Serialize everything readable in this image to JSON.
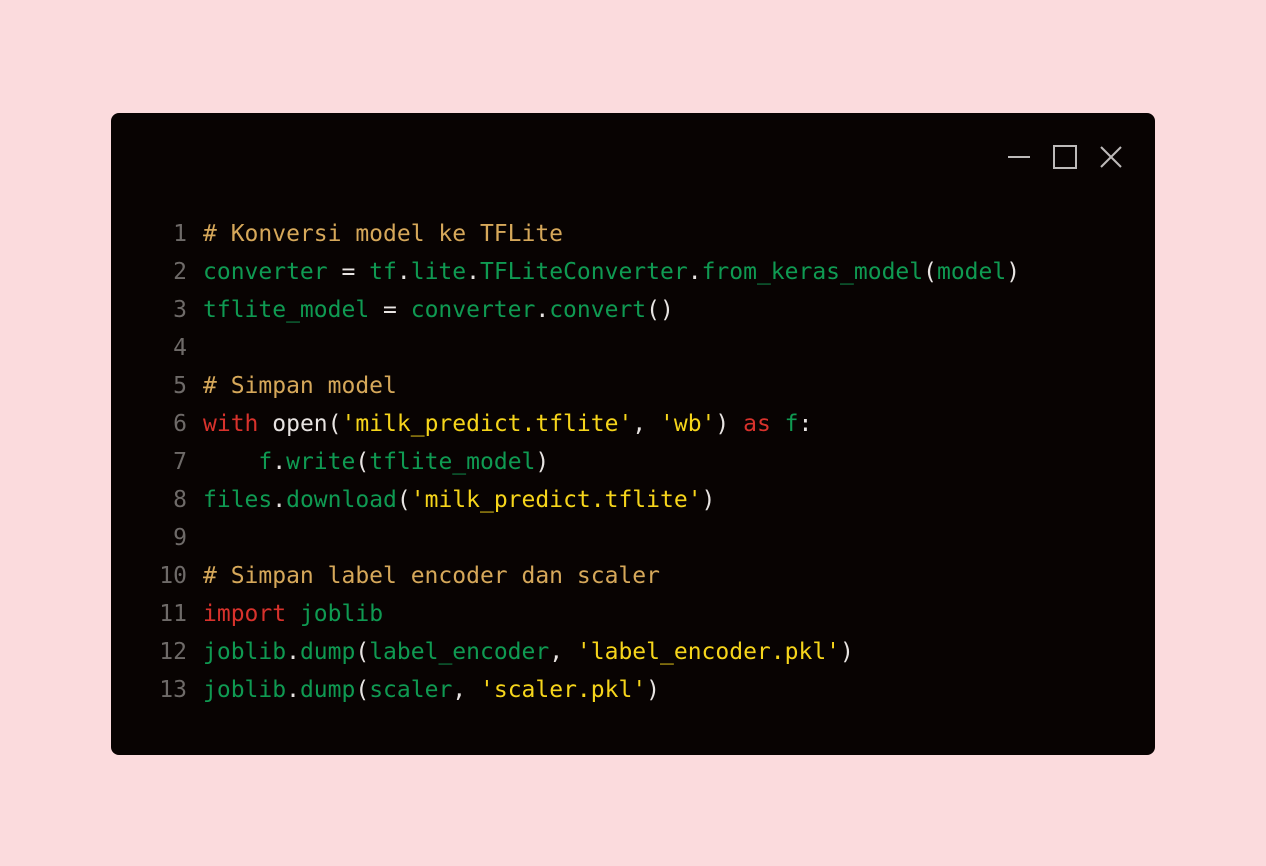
{
  "window": {
    "controls": {
      "minimize_icon": "minimize-icon",
      "maximize_icon": "maximize-icon",
      "close_icon": "close-icon"
    }
  },
  "colors": {
    "background": "#fbdbdd",
    "editor": "#080302",
    "comment": "#d6a85a",
    "keyword": "#d8322c",
    "identifier": "#0f9a52",
    "string": "#f6d51b",
    "punctuation": "#e8e4e2",
    "line_number": "#6e6a68"
  },
  "code": {
    "lines": [
      {
        "number": "1",
        "tokens": [
          {
            "t": "comment",
            "v": "# Konversi model ke TFLite"
          }
        ]
      },
      {
        "number": "2",
        "tokens": [
          {
            "t": "id",
            "v": "converter"
          },
          {
            "t": "punc",
            "v": " = "
          },
          {
            "t": "id",
            "v": "tf"
          },
          {
            "t": "punc",
            "v": "."
          },
          {
            "t": "id",
            "v": "lite"
          },
          {
            "t": "punc",
            "v": "."
          },
          {
            "t": "id",
            "v": "TFLiteConverter"
          },
          {
            "t": "punc",
            "v": "."
          },
          {
            "t": "id",
            "v": "from_keras_model"
          },
          {
            "t": "punc",
            "v": "("
          },
          {
            "t": "id",
            "v": "model"
          },
          {
            "t": "punc",
            "v": ")"
          }
        ]
      },
      {
        "number": "3",
        "tokens": [
          {
            "t": "id",
            "v": "tflite_model"
          },
          {
            "t": "punc",
            "v": " = "
          },
          {
            "t": "id",
            "v": "converter"
          },
          {
            "t": "punc",
            "v": "."
          },
          {
            "t": "id",
            "v": "convert"
          },
          {
            "t": "punc",
            "v": "()"
          }
        ]
      },
      {
        "number": "4",
        "tokens": []
      },
      {
        "number": "5",
        "tokens": [
          {
            "t": "comment",
            "v": "# Simpan model"
          }
        ]
      },
      {
        "number": "6",
        "tokens": [
          {
            "t": "kw",
            "v": "with"
          },
          {
            "t": "punc",
            "v": " "
          },
          {
            "t": "builtin",
            "v": "open"
          },
          {
            "t": "punc",
            "v": "("
          },
          {
            "t": "str",
            "v": "'milk_predict.tflite'"
          },
          {
            "t": "punc",
            "v": ", "
          },
          {
            "t": "str",
            "v": "'wb'"
          },
          {
            "t": "punc",
            "v": ") "
          },
          {
            "t": "kw",
            "v": "as"
          },
          {
            "t": "punc",
            "v": " "
          },
          {
            "t": "id",
            "v": "f"
          },
          {
            "t": "punc",
            "v": ":"
          }
        ]
      },
      {
        "number": "7",
        "tokens": [
          {
            "t": "punc",
            "v": "    "
          },
          {
            "t": "id",
            "v": "f"
          },
          {
            "t": "punc",
            "v": "."
          },
          {
            "t": "id",
            "v": "write"
          },
          {
            "t": "punc",
            "v": "("
          },
          {
            "t": "id",
            "v": "tflite_model"
          },
          {
            "t": "punc",
            "v": ")"
          }
        ]
      },
      {
        "number": "8",
        "tokens": [
          {
            "t": "id",
            "v": "files"
          },
          {
            "t": "punc",
            "v": "."
          },
          {
            "t": "id",
            "v": "download"
          },
          {
            "t": "punc",
            "v": "("
          },
          {
            "t": "str",
            "v": "'milk_predict.tflite'"
          },
          {
            "t": "punc",
            "v": ")"
          }
        ]
      },
      {
        "number": "9",
        "tokens": []
      },
      {
        "number": "10",
        "tokens": [
          {
            "t": "comment",
            "v": "# Simpan label encoder dan scaler"
          }
        ]
      },
      {
        "number": "11",
        "tokens": [
          {
            "t": "kw",
            "v": "import"
          },
          {
            "t": "punc",
            "v": " "
          },
          {
            "t": "id",
            "v": "joblib"
          }
        ]
      },
      {
        "number": "12",
        "tokens": [
          {
            "t": "id",
            "v": "joblib"
          },
          {
            "t": "punc",
            "v": "."
          },
          {
            "t": "id",
            "v": "dump"
          },
          {
            "t": "punc",
            "v": "("
          },
          {
            "t": "id",
            "v": "label_encoder"
          },
          {
            "t": "punc",
            "v": ", "
          },
          {
            "t": "str",
            "v": "'label_encoder.pkl'"
          },
          {
            "t": "punc",
            "v": ")"
          }
        ]
      },
      {
        "number": "13",
        "tokens": [
          {
            "t": "id",
            "v": "joblib"
          },
          {
            "t": "punc",
            "v": "."
          },
          {
            "t": "id",
            "v": "dump"
          },
          {
            "t": "punc",
            "v": "("
          },
          {
            "t": "id",
            "v": "scaler"
          },
          {
            "t": "punc",
            "v": ", "
          },
          {
            "t": "str",
            "v": "'scaler.pkl'"
          },
          {
            "t": "punc",
            "v": ")"
          }
        ]
      }
    ]
  }
}
